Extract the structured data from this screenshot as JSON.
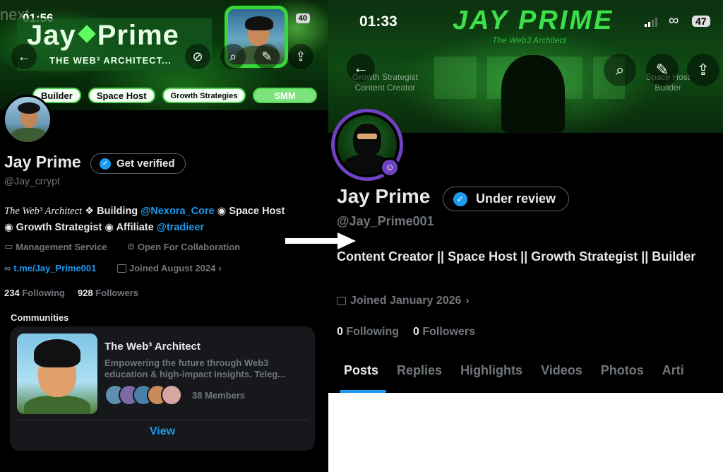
{
  "left_profile": {
    "status_time": "01:56",
    "status_ghost": "next",
    "battery": "40",
    "banner_logo_title_a": "Jay",
    "banner_logo_title_b": "Prime",
    "banner_logo_subtitle": "THE WEB³ ARCHITECT...",
    "tags": [
      "Builder",
      "Space Host",
      "Growth Strategies",
      "SMM"
    ],
    "name": "Jay Prime",
    "verify_button": "Get verified",
    "handle": "@Jay_crrypt",
    "bio": {
      "prefix": "The Web³ Architect",
      "part1": " ❖ Building ",
      "mention1": "@Nexora_Core",
      "part2": " ◉ Space Host",
      "part3": "◉ Growth Strategist ◉ Affiliate ",
      "mention2": "@tradieer"
    },
    "category": "Management Service",
    "location": "Open For Collaboration",
    "link": "t.me/Jay_Prime001",
    "joined": "Joined August 2024",
    "following_count": "234",
    "following_label": "Following",
    "followers_count": "928",
    "followers_label": "Followers",
    "communities_heading": "Communities",
    "community": {
      "name": "The Web³ Architect",
      "description": "Empowering the future through Web3 education & high-impact insights. Teleg...",
      "members": "38 Members",
      "view_button": "View"
    }
  },
  "right_profile": {
    "status_time": "01:33",
    "battery": "47",
    "banner_title": "JAY PRIME",
    "banner_subtitle": "The Web3 Architect",
    "banner_left_text": [
      "Growth Strategist",
      "Content Creator"
    ],
    "banner_right_text": [
      "Space Host",
      "Builder"
    ],
    "name": "Jay Prime",
    "verify_status": "Under review",
    "handle": "@Jay_Prime001",
    "bio": "Content Creator || Space Host || Growth Strategist || Builder",
    "joined": "Joined January 2026",
    "following_count": "0",
    "following_label": "Following",
    "followers_count": "0",
    "followers_label": "Followers",
    "tabs": [
      "Posts",
      "Replies",
      "Highlights",
      "Videos",
      "Photos",
      "Arti"
    ]
  },
  "colors": {
    "accent_blue": "#1d9bf0",
    "neon_green": "#3ee04a",
    "avatar_ring": "#6f42c1",
    "muted_text": "#71767b"
  },
  "icons": [
    "back-arrow-icon",
    "search-icon",
    "edit-icon",
    "share-icon",
    "link-icon",
    "verified-badge-icon",
    "calendar-icon",
    "briefcase-icon",
    "location-icon",
    "chevron-right-icon",
    "arrow-right-icon"
  ]
}
